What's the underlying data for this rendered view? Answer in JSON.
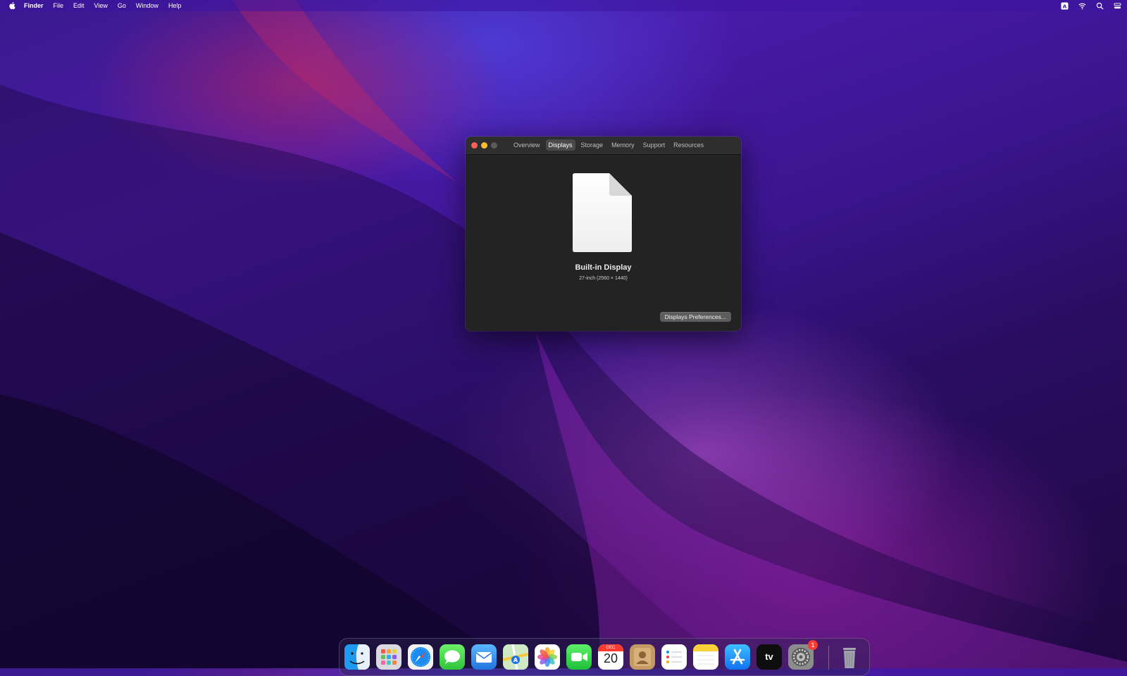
{
  "menubar": {
    "app_name": "Finder",
    "items": [
      "File",
      "Edit",
      "View",
      "Go",
      "Window",
      "Help"
    ],
    "right_icons": [
      "input-source-icon",
      "wifi-icon",
      "spotlight-icon",
      "control-center-icon"
    ]
  },
  "window": {
    "tabs": [
      {
        "label": "Overview",
        "active": false
      },
      {
        "label": "Displays",
        "active": true
      },
      {
        "label": "Storage",
        "active": false
      },
      {
        "label": "Memory",
        "active": false
      },
      {
        "label": "Support",
        "active": false
      },
      {
        "label": "Resources",
        "active": false
      }
    ],
    "display_name": "Built-in Display",
    "display_size": "27-inch (2560 × 1440)",
    "preferences_button": "Displays Preferences..."
  },
  "dock": {
    "apps": [
      {
        "name": "finder-icon"
      },
      {
        "name": "launchpad-icon"
      },
      {
        "name": "safari-icon"
      },
      {
        "name": "messages-icon"
      },
      {
        "name": "mail-icon"
      },
      {
        "name": "maps-icon"
      },
      {
        "name": "photos-icon"
      },
      {
        "name": "facetime-icon"
      },
      {
        "name": "calendar-icon",
        "month": "DEC",
        "day": "20"
      },
      {
        "name": "contacts-icon"
      },
      {
        "name": "reminders-icon"
      },
      {
        "name": "notes-icon"
      },
      {
        "name": "app-store-icon"
      },
      {
        "name": "apple-tv-icon",
        "label": "tv"
      },
      {
        "name": "system-preferences-icon",
        "badge": "1"
      },
      {
        "name": "trash-icon"
      }
    ]
  }
}
